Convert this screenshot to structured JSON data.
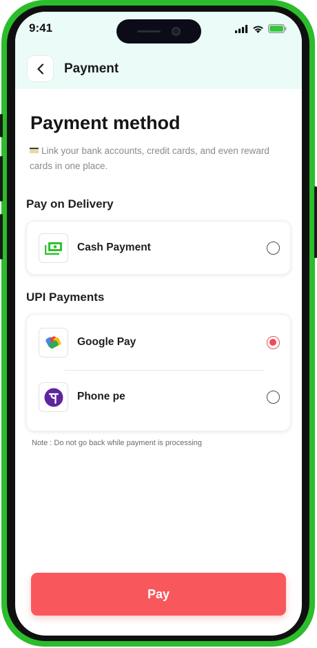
{
  "status_bar": {
    "time": "9:41"
  },
  "header": {
    "title": "Payment"
  },
  "page": {
    "title": "Payment method",
    "subtitle": "Link your bank accounts, credit cards, and even reward cards in one place."
  },
  "sections": [
    {
      "title": "Pay on Delivery",
      "options": [
        {
          "label": "Cash Payment",
          "icon": "cash-icon",
          "selected": false
        }
      ]
    },
    {
      "title": "UPI Payments",
      "options": [
        {
          "label": "Google Pay",
          "icon": "google-pay-icon",
          "selected": true
        },
        {
          "label": "Phone pe",
          "icon": "phonepe-icon",
          "selected": false
        }
      ]
    }
  ],
  "note": "Note : Do not go back while payment is processing",
  "pay_button": {
    "label": "Pay"
  },
  "colors": {
    "frame": "#2bbd2b",
    "header_bg": "#eafbf8",
    "accent": "#f8585c",
    "radio_selected": "#ef4b55",
    "cash_green": "#2fc12f",
    "phonepe_purple": "#5f259f"
  }
}
